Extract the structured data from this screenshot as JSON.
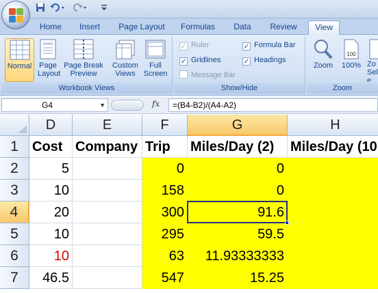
{
  "qat": {
    "save_icon": "save-icon",
    "undo_icon": "undo-icon",
    "redo_icon": "redo-icon",
    "customize_icon": "customize-icon"
  },
  "tabs": [
    {
      "label": "Home"
    },
    {
      "label": "Insert"
    },
    {
      "label": "Page Layout"
    },
    {
      "label": "Formulas"
    },
    {
      "label": "Data"
    },
    {
      "label": "Review"
    },
    {
      "label": "View",
      "active": true
    }
  ],
  "ribbon": {
    "workbook_views": {
      "label": "Workbook Views",
      "normal": "Normal",
      "page_layout": "Page Layout",
      "page_break_preview": "Page Break Preview",
      "custom_views": "Custom Views",
      "full_screen": "Full Screen"
    },
    "show_hide": {
      "label": "Show/Hide",
      "ruler": {
        "label": "Ruler",
        "checked": true,
        "enabled": false
      },
      "gridlines": {
        "label": "Gridlines",
        "checked": true
      },
      "message_bar": {
        "label": "Message Bar",
        "checked": false,
        "enabled": false
      },
      "formula_bar": {
        "label": "Formula Bar",
        "checked": true
      },
      "headings": {
        "label": "Headings",
        "checked": true
      }
    },
    "zoom": {
      "label": "Zoom",
      "zoom": "Zoom",
      "hundred": "100%",
      "zoom_to_selection": "Zo Sele",
      "hundred_icon_text": "100"
    }
  },
  "formula_bar": {
    "name_box": "G4",
    "fx": "fx",
    "formula": "=(B4-B2)/(A4-A2)"
  },
  "grid": {
    "columns": [
      "D",
      "E",
      "F",
      "G",
      "H"
    ],
    "selected_column": "G",
    "rows": [
      "1",
      "2",
      "3",
      "4",
      "5",
      "6",
      "7"
    ],
    "selected_row": "4",
    "header_row": [
      "Cost",
      "Company",
      "Trip",
      "Miles/Day (2)",
      "Miles/Day (10"
    ],
    "data": [
      [
        "5",
        "",
        "0",
        "0",
        ""
      ],
      [
        "10",
        "",
        "158",
        "0",
        ""
      ],
      [
        "20",
        "",
        "300",
        "91.6",
        ""
      ],
      [
        "10",
        "",
        "295",
        "59.5",
        ""
      ],
      [
        "10",
        "",
        "63",
        "11.93333333",
        ""
      ],
      [
        "46.5",
        "",
        "547",
        "15.25",
        ""
      ]
    ],
    "red_cell_value": "10",
    "fill_color": "#ffff00",
    "active_cell": "G4"
  }
}
